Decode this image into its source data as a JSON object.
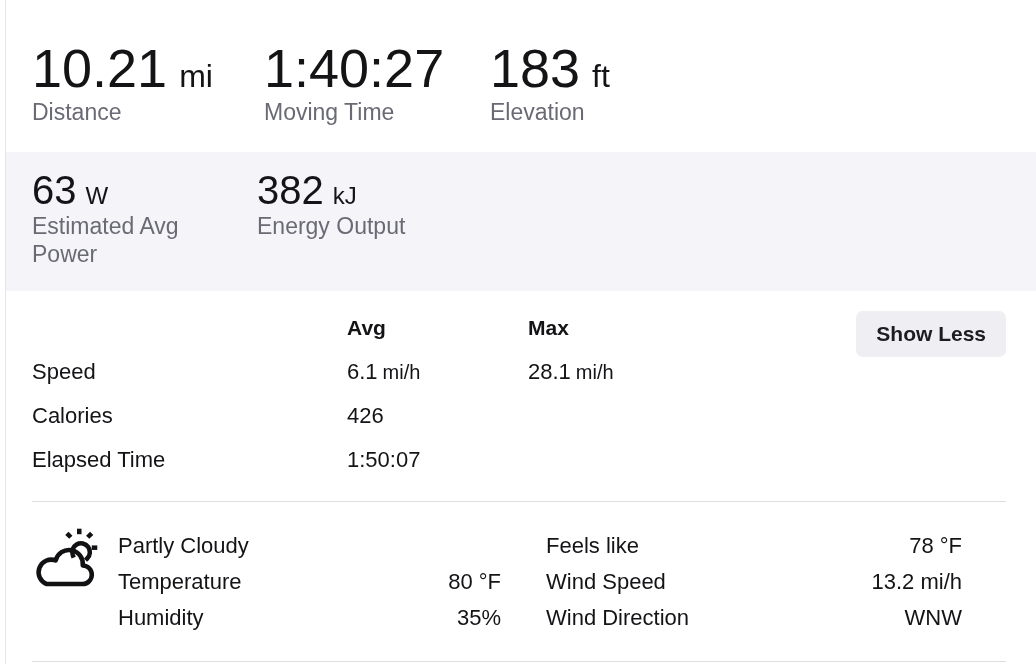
{
  "primary_stats": [
    {
      "value": "10.21",
      "unit": "mi",
      "label": "Distance"
    },
    {
      "value": "1:40:27",
      "label": "Moving Time"
    },
    {
      "value": "183",
      "unit": "ft",
      "label": "Elevation"
    }
  ],
  "secondary_stats": [
    {
      "value": "63",
      "unit": "W",
      "label": "Estimated Avg Power"
    },
    {
      "value": "382",
      "unit": "kJ",
      "label": "Energy Output"
    }
  ],
  "details": {
    "columns": [
      "Avg",
      "Max"
    ],
    "toggle_button": "Show Less",
    "rows": [
      {
        "label": "Speed",
        "cells": [
          {
            "value": "6.1",
            "unit": "mi/h"
          },
          {
            "value": "28.1",
            "unit": "mi/h"
          }
        ]
      },
      {
        "label": "Calories",
        "cells": [
          {
            "value": "426"
          }
        ]
      },
      {
        "label": "Elapsed Time",
        "cells": [
          {
            "value": "1:50:07"
          }
        ]
      }
    ]
  },
  "weather": {
    "condition": "Partly Cloudy",
    "left_column": [
      {
        "label": "Temperature",
        "value": "80 °F"
      },
      {
        "label": "Humidity",
        "value": "35%"
      }
    ],
    "right_column": [
      {
        "label": "Feels like",
        "value": "78 °F"
      },
      {
        "label": "Wind Speed",
        "value": "13.2 mi/h"
      },
      {
        "label": "Wind Direction",
        "value": "WNW"
      }
    ]
  }
}
